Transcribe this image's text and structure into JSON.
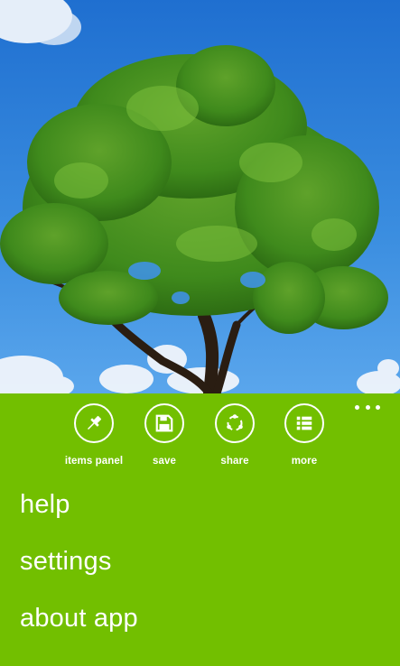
{
  "photo": {
    "subject": "tree-under-blue-sky"
  },
  "app_bar": {
    "background": "#72bf00",
    "buttons": [
      {
        "label": "items panel",
        "icon": "pin-icon"
      },
      {
        "label": "save",
        "icon": "floppy-disk-icon"
      },
      {
        "label": "share",
        "icon": "share-icon"
      },
      {
        "label": "more",
        "icon": "list-icon"
      }
    ],
    "menu_items": [
      "help",
      "settings",
      "about app"
    ]
  }
}
